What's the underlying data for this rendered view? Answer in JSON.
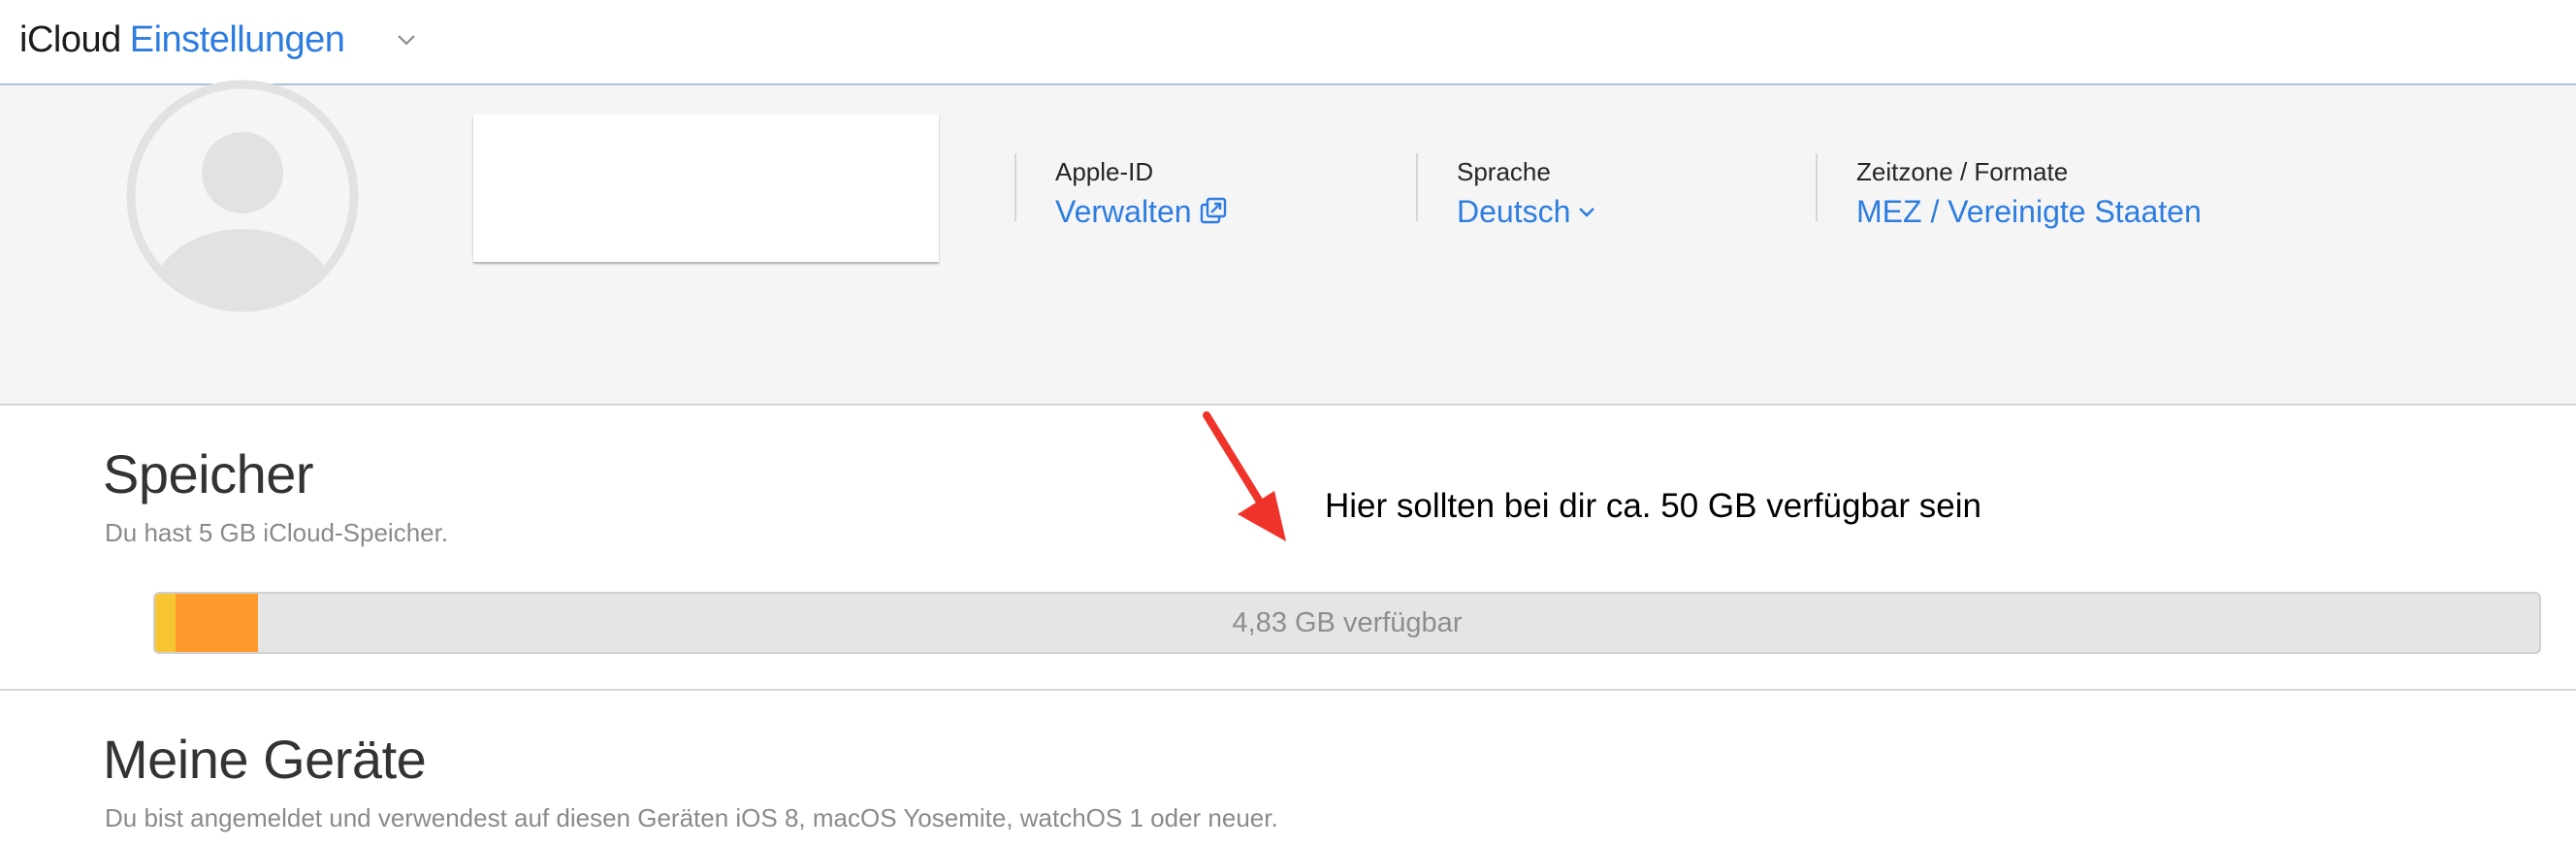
{
  "header": {
    "app_name": "iCloud",
    "section_name": "Einstellungen",
    "menu_icon": "chevron-down-icon"
  },
  "account": {
    "avatar_icon": "user-silhouette-icon",
    "apple_id": {
      "label": "Apple-ID",
      "link": "Verwalten",
      "icon": "external-link-icon"
    },
    "language": {
      "label": "Sprache",
      "value": "Deutsch",
      "icon": "chevron-down-icon"
    },
    "timezone": {
      "label": "Zeitzone / Formate",
      "value": "MEZ / Vereinigte Staaten"
    }
  },
  "storage": {
    "title": "Speicher",
    "subtitle": "Du hast 5 GB iCloud-Speicher.",
    "available_label": "4,83 GB verfügbar",
    "segments": [
      {
        "color": "#f7c531",
        "fraction": 0.0086
      },
      {
        "color": "#fd9a2b",
        "fraction": 0.0345
      }
    ],
    "track_color": "#e5e5e5"
  },
  "annotation": {
    "text": "Hier sollten bei dir ca. 50 GB verfügbar sein",
    "arrow_color": "#f0332a",
    "arrow_icon": "red-arrow-icon"
  },
  "devices": {
    "title": "Meine Geräte",
    "subtitle": "Du bist angemeldet und verwendest auf diesen Geräten iOS 8, macOS Yosemite, watchOS 1 oder neuer."
  },
  "colors": {
    "accent": "#2d7de0",
    "header_border": "#a9c3da",
    "band_background": "#f5f5f5"
  }
}
